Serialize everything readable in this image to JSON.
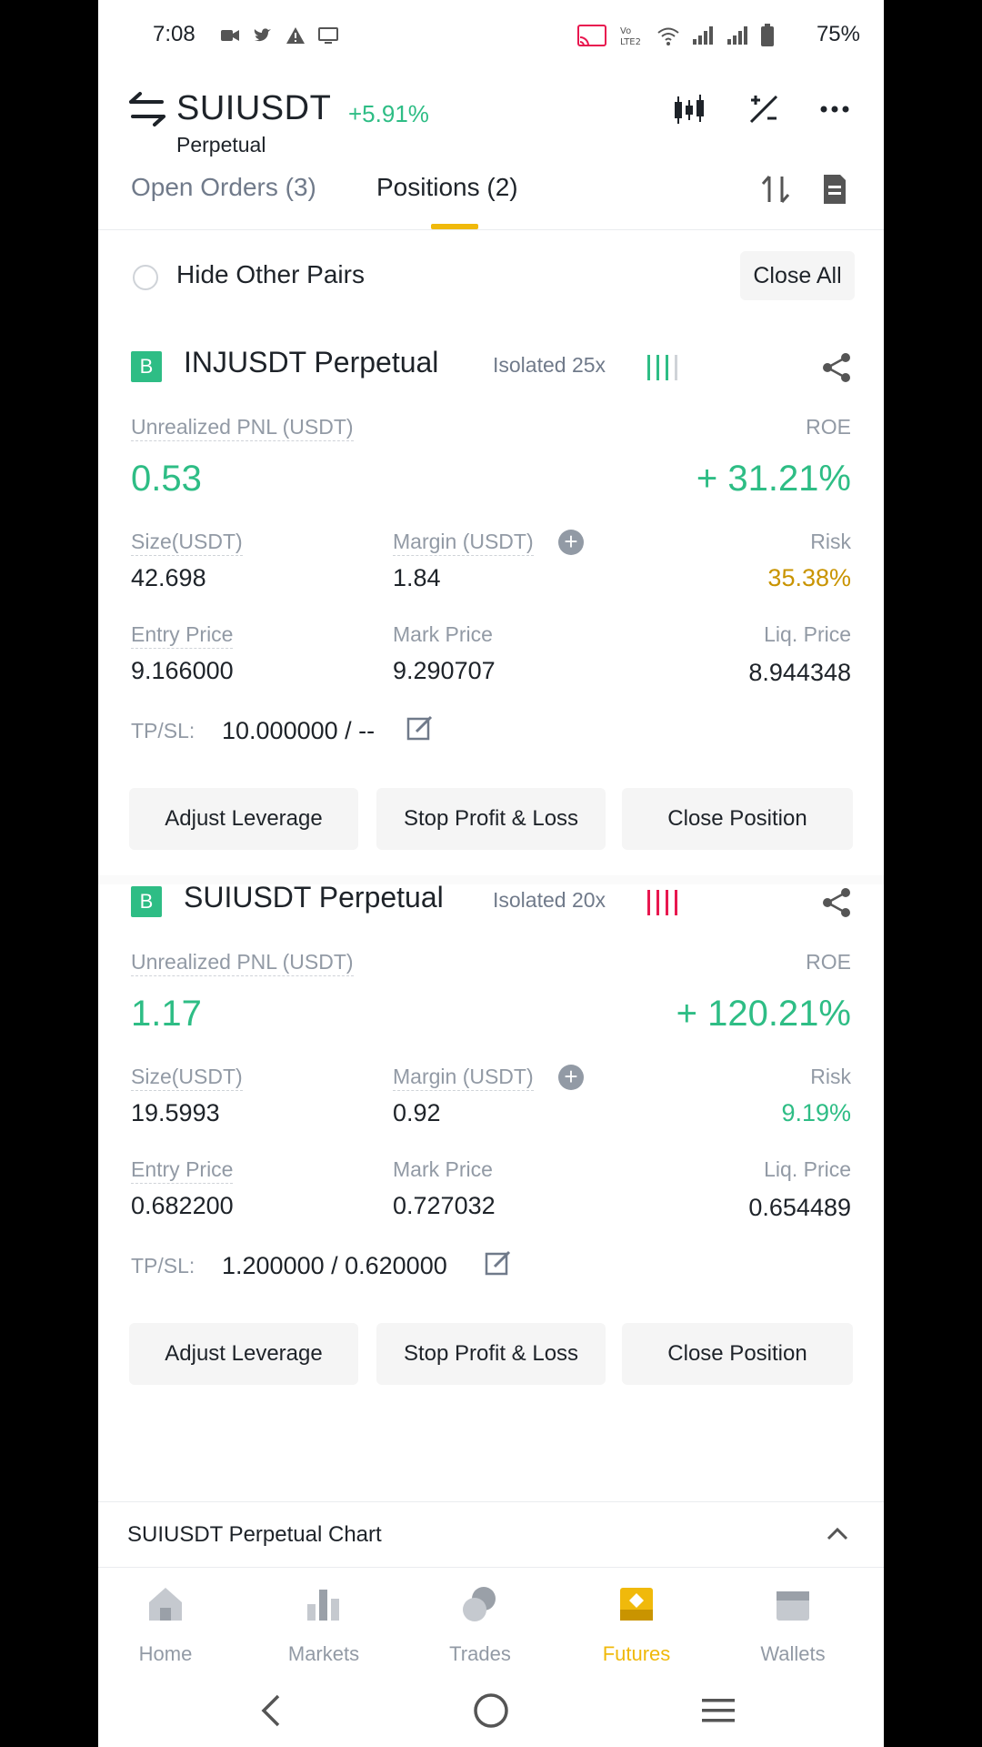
{
  "status": {
    "time": "7:08",
    "battery": "75%"
  },
  "header": {
    "pair": "SUIUSDT",
    "change": "+5.91%",
    "type": "Perpetual"
  },
  "tabs": [
    {
      "label": "Open Orders (3)"
    },
    {
      "label": "Positions (2)"
    }
  ],
  "filter": {
    "hide_label": "Hide Other Pairs",
    "close_all": "Close All"
  },
  "positions": [
    {
      "badge": "B",
      "title": "INJUSDT Perpetual",
      "margin_mode": "Isolated 25x",
      "risk_color": "#2ebd85",
      "pnl_label": "Unrealized PNL (USDT)",
      "pnl": "0.53",
      "roe_label": "ROE",
      "roe": "+ 31.21%",
      "size_label": "Size(USDT)",
      "size": "42.698",
      "margin_label": "Margin (USDT)",
      "margin": "1.84",
      "risk_label": "Risk",
      "risk": "35.38%",
      "risk_value_color": "#c99400",
      "entry_label": "Entry Price",
      "entry": "9.166000",
      "mark_label": "Mark Price",
      "mark": "9.290707",
      "liq_label": "Liq. Price",
      "liq": "8.944348",
      "tpsl_label": "TP/SL:",
      "tpsl": "10.000000 / --",
      "actions": [
        "Adjust Leverage",
        "Stop Profit & Loss",
        "Close Position"
      ]
    },
    {
      "badge": "B",
      "title": "SUIUSDT Perpetual",
      "margin_mode": "Isolated 20x",
      "risk_color": "#e8174f",
      "pnl_label": "Unrealized PNL (USDT)",
      "pnl": "1.17",
      "roe_label": "ROE",
      "roe": "+ 120.21%",
      "size_label": "Size(USDT)",
      "size": "19.5993",
      "margin_label": "Margin (USDT)",
      "margin": "0.92",
      "risk_label": "Risk",
      "risk": "9.19%",
      "risk_value_color": "#2ebd85",
      "entry_label": "Entry Price",
      "entry": "0.682200",
      "mark_label": "Mark Price",
      "mark": "0.727032",
      "liq_label": "Liq. Price",
      "liq": "0.654489",
      "tpsl_label": "TP/SL:",
      "tpsl": "1.200000 / 0.620000",
      "actions": [
        "Adjust Leverage",
        "Stop Profit & Loss",
        "Close Position"
      ]
    }
  ],
  "chart_bar": {
    "label": "SUIUSDT Perpetual  Chart"
  },
  "nav": [
    {
      "label": "Home",
      "icon": "home-icon"
    },
    {
      "label": "Markets",
      "icon": "markets-icon"
    },
    {
      "label": "Trades",
      "icon": "trades-icon"
    },
    {
      "label": "Futures",
      "icon": "futures-icon",
      "active": true
    },
    {
      "label": "Wallets",
      "icon": "wallets-icon"
    }
  ],
  "colors": {
    "accent": "#f0b90b",
    "up": "#2ebd85",
    "down": "#e8174f",
    "muted": "#929aa5"
  }
}
